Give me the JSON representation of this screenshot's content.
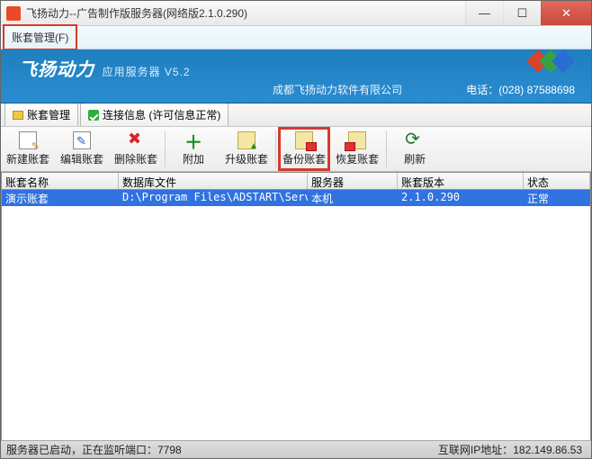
{
  "window": {
    "title": "飞扬动力--广告制作版服务器(网络版2.1.0.290)"
  },
  "menubar": {
    "account_mgmt": "账套管理(F)"
  },
  "banner": {
    "brand_main": "飞扬动力",
    "brand_sub": "应用服务器 V5.2",
    "company": "成都飞扬动力软件有限公司",
    "phone_label": "电话：",
    "phone_number": "(028) 87588698"
  },
  "tabs": {
    "account_mgmt": "账套管理",
    "conn_info": "连接信息 (许可信息正常)"
  },
  "toolbar": {
    "new": "新建账套",
    "edit": "编辑账套",
    "delete": "删除账套",
    "attach": "附加",
    "upgrade": "升级账套",
    "backup": "备份账套",
    "restore": "恢复账套",
    "refresh": "刷新"
  },
  "grid": {
    "headers": {
      "name": "账套名称",
      "dbfile": "数据库文件",
      "server": "服务器",
      "version": "账套版本",
      "status": "状态"
    },
    "rows": [
      {
        "name": "演示账套",
        "dbfile": "D:\\Program Files\\ADSTART\\Server\\",
        "server": "本机",
        "version": "2.1.0.290",
        "status": "正常"
      }
    ]
  },
  "statusbar": {
    "left": "服务器已启动，正在监听端口：7798",
    "right_label": "互联网IP地址：",
    "right_value": "182.149.86.53"
  }
}
